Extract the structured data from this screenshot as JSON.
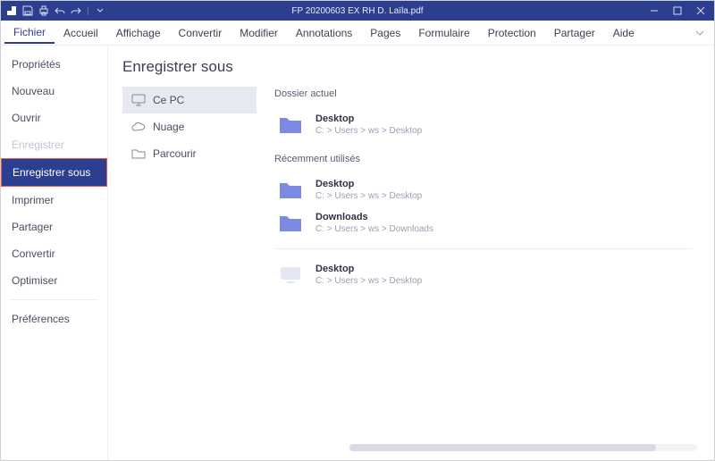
{
  "titlebar": {
    "title": "FP 20200603 EX RH D. Laïla.pdf"
  },
  "menubar": {
    "items": [
      "Fichier",
      "Accueil",
      "Affichage",
      "Convertir",
      "Modifier",
      "Annotations",
      "Pages",
      "Formulaire",
      "Protection",
      "Partager",
      "Aide"
    ],
    "active_index": 0
  },
  "sidebar": {
    "items": [
      {
        "label": "Propriétés"
      },
      {
        "label": "Nouveau"
      },
      {
        "label": "Ouvrir"
      },
      {
        "label": "Enregistrer",
        "disabled": true
      },
      {
        "label": "Enregistrer sous",
        "selected": true
      },
      {
        "label": "Imprimer"
      },
      {
        "label": "Partager"
      },
      {
        "label": "Convertir"
      },
      {
        "label": "Optimiser"
      }
    ],
    "footer": {
      "label": "Préférences"
    }
  },
  "panel": {
    "title": "Enregistrer sous",
    "locations": [
      {
        "label": "Ce PC",
        "icon": "monitor",
        "selected": true
      },
      {
        "label": "Nuage",
        "icon": "cloud"
      },
      {
        "label": "Parcourir",
        "icon": "folder"
      }
    ],
    "current_folder_label": "Dossier actuel",
    "current_folder": {
      "name": "Desktop",
      "path": "C: > Users > ws > Desktop",
      "icon": "folder-fill"
    },
    "recent_label": "Récemment utilisés",
    "recent": [
      {
        "name": "Desktop",
        "path": "C: > Users > ws > Desktop",
        "icon": "folder-fill"
      },
      {
        "name": "Downloads",
        "path": "C: > Users > ws > Downloads",
        "icon": "folder-fill"
      }
    ],
    "other": [
      {
        "name": "Desktop",
        "path": "C: > Users > ws > Desktop",
        "icon": "monitor-fill"
      }
    ]
  }
}
